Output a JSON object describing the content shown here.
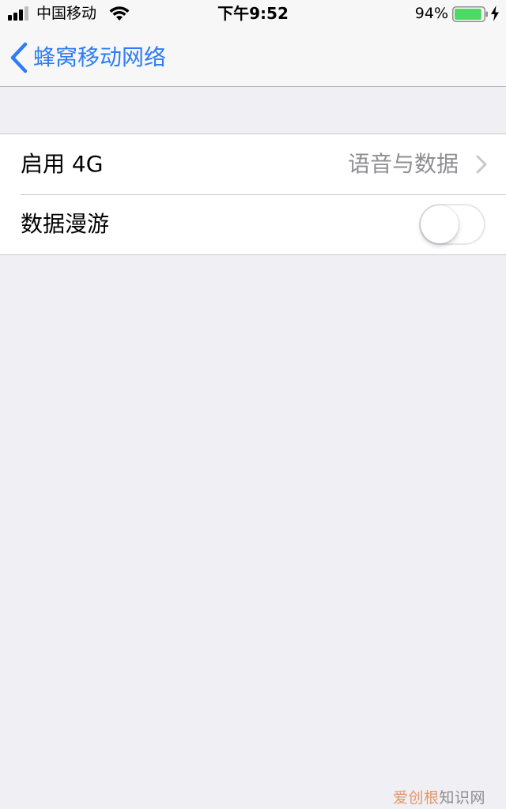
{
  "status_bar": {
    "carrier": "中国移动",
    "time": "下午9:52",
    "battery_percent": "94%",
    "battery_level": 0.94,
    "signal_bars_filled": 3,
    "signal_bars_total": 4,
    "charging": true,
    "battery_color": "#4cd964"
  },
  "nav": {
    "back_label": "蜂窝移动网络",
    "accent_color": "#2f7cf6"
  },
  "settings": {
    "enable_4g": {
      "label": "启用 4G",
      "value": "语音与数据",
      "icon": "chevron-right-icon"
    },
    "data_roaming": {
      "label": "数据漫游",
      "enabled": false
    }
  },
  "watermark": {
    "accent_part": "爱创根",
    "rest": "知识网"
  }
}
